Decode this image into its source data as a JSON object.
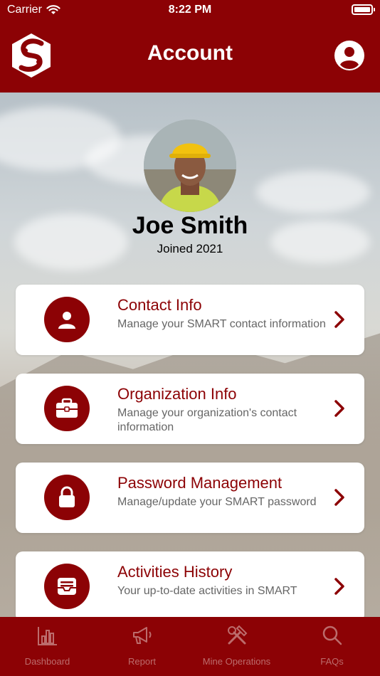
{
  "status_bar": {
    "carrier": "Carrier",
    "time": "8:22 PM"
  },
  "header": {
    "title": "Account"
  },
  "profile": {
    "name": "Joe Smith",
    "joined": "Joined 2021"
  },
  "menu": [
    {
      "title": "Contact Info",
      "description": "Manage your SMART contact information",
      "icon": "user-icon"
    },
    {
      "title": "Organization Info",
      "description": "Manage your organization's contact information",
      "icon": "briefcase-icon"
    },
    {
      "title": "Password Management",
      "description": "Manage/update your SMART password",
      "icon": "lock-icon"
    },
    {
      "title": "Activities History",
      "description": "Your up-to-date activities in SMART",
      "icon": "inbox-icon"
    }
  ],
  "tabbar": [
    {
      "label": "Dashboard",
      "icon": "bar-chart-icon"
    },
    {
      "label": "Report",
      "icon": "megaphone-icon"
    },
    {
      "label": "Mine Operations",
      "icon": "tools-icon"
    },
    {
      "label": "FAQs",
      "icon": "search-icon"
    }
  ],
  "colors": {
    "brand": "#8c0205",
    "tab_inactive": "#bc6c6c",
    "card_bg": "#ffffff"
  }
}
